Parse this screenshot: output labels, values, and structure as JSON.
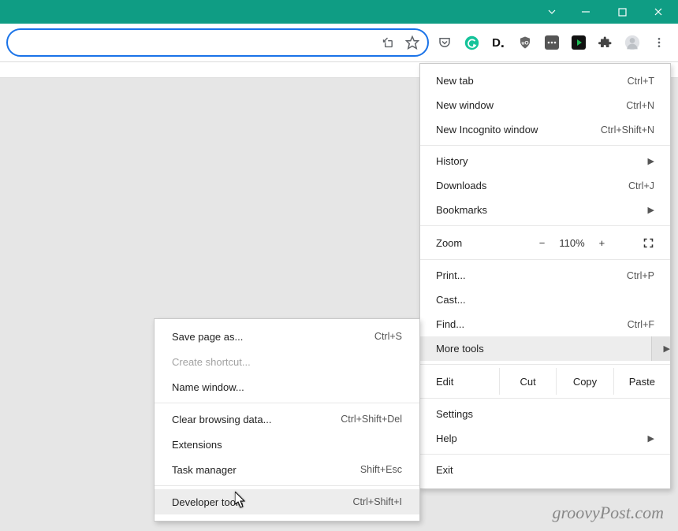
{
  "window": {
    "controls": {
      "chevron": "chevron-down",
      "min": "minimize",
      "max": "maximize",
      "close": "close"
    }
  },
  "toolbar": {
    "share_icon": "share-icon",
    "star_icon": "star-icon",
    "ext": [
      "pocket",
      "grammarly",
      "darkreader",
      "ublock",
      "chatgpt",
      "spotify",
      "puzzle",
      "profile",
      "kebab"
    ]
  },
  "menu": {
    "new_tab": {
      "label": "New tab",
      "shortcut": "Ctrl+T"
    },
    "new_window": {
      "label": "New window",
      "shortcut": "Ctrl+N"
    },
    "new_incognito": {
      "label": "New Incognito window",
      "shortcut": "Ctrl+Shift+N"
    },
    "history": {
      "label": "History"
    },
    "downloads": {
      "label": "Downloads",
      "shortcut": "Ctrl+J"
    },
    "bookmarks": {
      "label": "Bookmarks"
    },
    "zoom": {
      "label": "Zoom",
      "minus": "−",
      "value": "110%",
      "plus": "+"
    },
    "print": {
      "label": "Print...",
      "shortcut": "Ctrl+P"
    },
    "cast": {
      "label": "Cast..."
    },
    "find": {
      "label": "Find...",
      "shortcut": "Ctrl+F"
    },
    "more_tools": {
      "label": "More tools"
    },
    "edit": {
      "label": "Edit",
      "cut": "Cut",
      "copy": "Copy",
      "paste": "Paste"
    },
    "settings": {
      "label": "Settings"
    },
    "help": {
      "label": "Help"
    },
    "exit": {
      "label": "Exit"
    }
  },
  "submenu": {
    "save_page": {
      "label": "Save page as...",
      "shortcut": "Ctrl+S"
    },
    "create_shortcut": {
      "label": "Create shortcut..."
    },
    "name_window": {
      "label": "Name window..."
    },
    "clear_data": {
      "label": "Clear browsing data...",
      "shortcut": "Ctrl+Shift+Del"
    },
    "extensions": {
      "label": "Extensions"
    },
    "task_manager": {
      "label": "Task manager",
      "shortcut": "Shift+Esc"
    },
    "dev_tools": {
      "label": "Developer tools",
      "shortcut": "Ctrl+Shift+I"
    }
  },
  "watermark": "groovyPost.com"
}
